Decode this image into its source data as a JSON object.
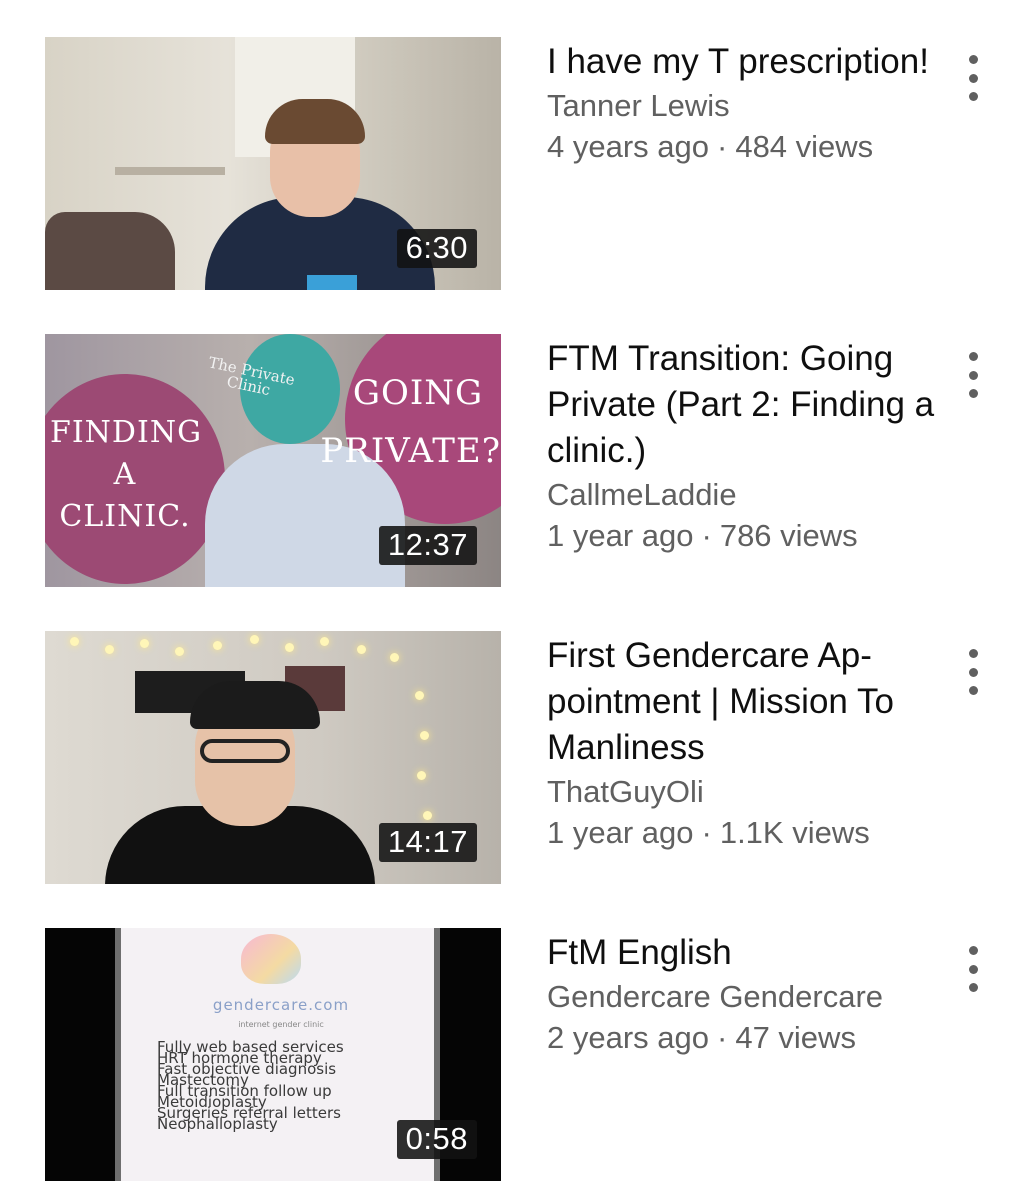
{
  "videos": [
    {
      "title": "I have my T prescription!",
      "channel": "Tanner Lewis",
      "age": "4 years ago",
      "views": "484 views",
      "duration": "6:30"
    },
    {
      "title": "FTM Transition: Going Private (Part 2: Finding a clinic.)",
      "channel": "CallmeLaddie",
      "age": "1 year ago",
      "views": "786 views",
      "duration": "12:37",
      "thumb_text": {
        "left": "FINDING A CLINIC.",
        "right": "GOING PRIVATE?!",
        "clinic": "The Private Clinic"
      }
    },
    {
      "title": "First Gendercare Ap-pointment | Mission To Manliness",
      "channel": "ThatGuyOli",
      "age": "1 year ago",
      "views": "1.1K views",
      "duration": "14:17"
    },
    {
      "title": "FtM English",
      "channel": "Gendercare Gendercare",
      "age": "2 years ago",
      "views": "47 views",
      "duration": "0:58",
      "thumb_text": {
        "logo": "gendercare.com",
        "sub": "internet gender clinic",
        "lines": [
          "Fully web based services",
          "HRT hormone therapy",
          "Fast objective diagnosis",
          "Mastectomy",
          "Full transition follow up",
          "Metoidioplasty",
          "Surgeries referral letters",
          "Neophalloplasty"
        ]
      }
    }
  ],
  "separator": "·",
  "icons": {
    "more": "more-vertical-icon"
  },
  "colors": {
    "title": "#0f0f0f",
    "secondary": "#606060",
    "duration_bg": "#121212"
  }
}
